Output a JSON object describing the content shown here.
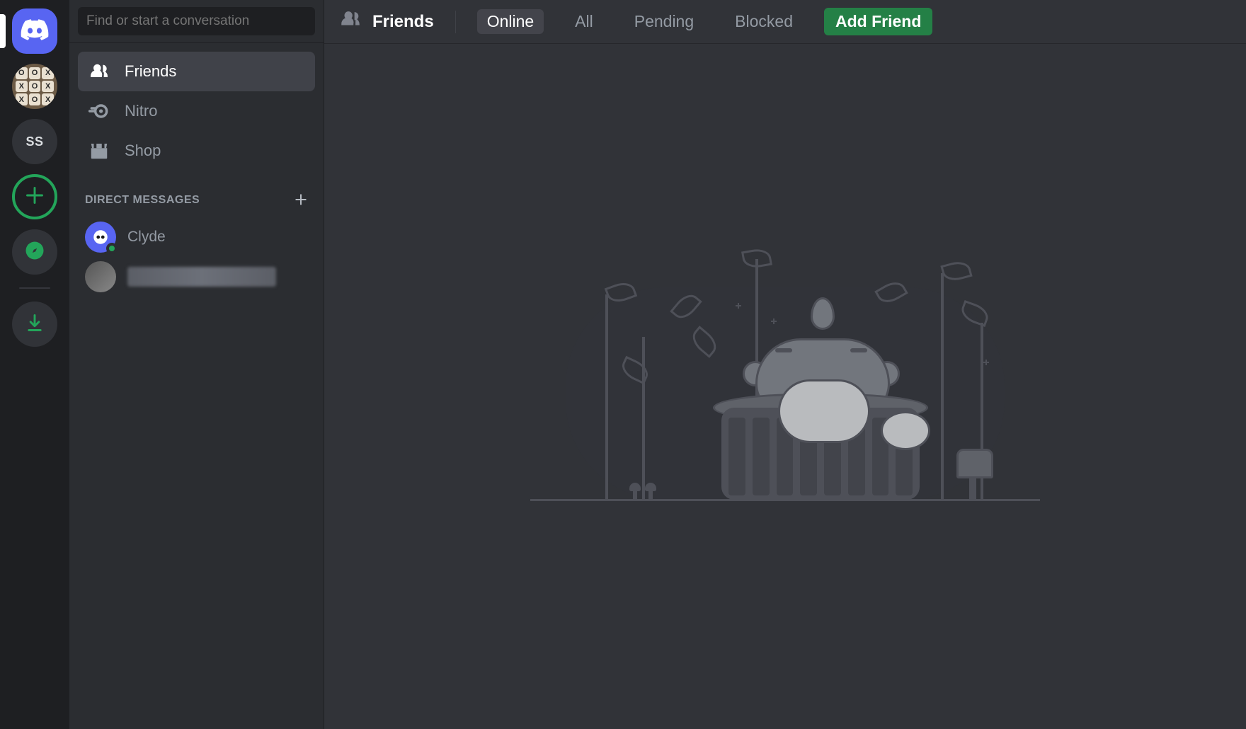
{
  "server_rail": {
    "home_icon": "discord-logo",
    "servers": [
      {
        "id": "ttt",
        "type": "image"
      },
      {
        "id": "ss",
        "label": "SS"
      }
    ],
    "add_tooltip": "Add a Server",
    "explore_tooltip": "Explore Discoverable Servers",
    "download_tooltip": "Download Apps"
  },
  "search": {
    "placeholder": "Find or start a conversation"
  },
  "nav": {
    "friends_label": "Friends",
    "nitro_label": "Nitro",
    "shop_label": "Shop"
  },
  "dm_section": {
    "header": "DIRECT MESSAGES",
    "items": [
      {
        "name": "Clyde",
        "avatar": "clyde",
        "online": true
      },
      {
        "name": "████████████",
        "avatar": "blurred",
        "online": false,
        "redacted": true
      }
    ]
  },
  "topbar": {
    "title": "Friends",
    "tabs": {
      "online": "Online",
      "all": "All",
      "pending": "Pending",
      "blocked": "Blocked"
    },
    "add_friend_button": "Add Friend",
    "active_tab": "online"
  },
  "colors": {
    "brand": "#5865f2",
    "green": "#23a55a",
    "bg_dark": "#1e1f22",
    "bg_sidebar": "#2b2d31",
    "bg_main": "#313338"
  }
}
